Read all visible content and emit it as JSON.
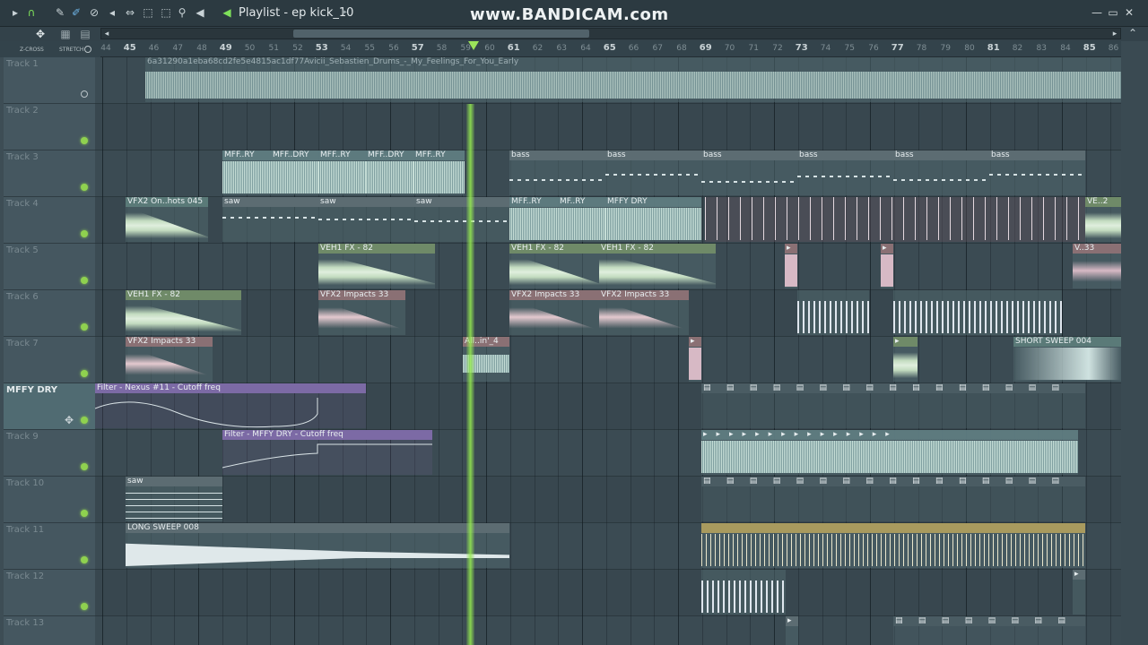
{
  "window": {
    "title": "Playlist - ep kick_10",
    "watermark": "www.BANDICAM.com"
  },
  "toolbar": {
    "icons": [
      "arrow-right-icon",
      "magnet-icon",
      "pencil-icon",
      "brush-icon",
      "mute-icon",
      "slice-icon",
      "select-icon",
      "zoom-icon",
      "speaker-icon",
      "play-icon"
    ],
    "zcross_label": "Z-CROSS",
    "stretch_label": "STRETCH"
  },
  "ruler": {
    "bars": [
      "44",
      "45",
      "46",
      "47",
      "48",
      "49",
      "50",
      "51",
      "52",
      "53",
      "54",
      "55",
      "56",
      "57",
      "58",
      "59",
      "60",
      "61",
      "62",
      "63",
      "64",
      "65",
      "66",
      "67",
      "68",
      "69",
      "70",
      "71",
      "72",
      "73",
      "74",
      "75",
      "76",
      "77",
      "78",
      "79",
      "80",
      "81",
      "82",
      "83",
      "84",
      "85",
      "86"
    ],
    "major": [
      "45",
      "49",
      "53",
      "57",
      "61",
      "65",
      "69",
      "73",
      "77",
      "81",
      "85"
    ]
  },
  "tracks": [
    {
      "name": "Track 1",
      "led": "off"
    },
    {
      "name": "Track 2",
      "led": "on"
    },
    {
      "name": "Track 3",
      "led": "on"
    },
    {
      "name": "Track 4",
      "led": "on"
    },
    {
      "name": "Track 5",
      "led": "on"
    },
    {
      "name": "Track 6",
      "led": "on"
    },
    {
      "name": "Track 7",
      "led": "on"
    },
    {
      "name": "MFFY DRY",
      "led": "on"
    },
    {
      "name": "Track 9",
      "led": "on"
    },
    {
      "name": "Track 10",
      "led": "on"
    },
    {
      "name": "Track 11",
      "led": "on"
    },
    {
      "name": "Track 12",
      "led": "on"
    },
    {
      "name": "Track 13",
      "led": "on"
    }
  ],
  "clips": {
    "t1_sample": "6a31290a1eba68cd2fe5e4815ac1df77Avicii_Sebastien_Drums_-_My_Feelings_For_You_Early",
    "t3": [
      "MFF..RY",
      "MFF..DRY",
      "MFF..RY",
      "MFF..DRY",
      "MFF..RY",
      "bass",
      "bass",
      "bass",
      "bass",
      "bass",
      "bass"
    ],
    "t4": [
      "VFX2 On..hots 045",
      "saw",
      "saw",
      "saw",
      "MFF..RY",
      "MF..RY",
      "MFFY DRY",
      "VE..2"
    ],
    "t5": [
      "VEH1 FX - 82",
      "VEH1 FX - 82",
      "VEH1 FX - 82",
      "V..33"
    ],
    "t6": [
      "VEH1 FX - 82",
      "VFX2 Impacts 33",
      "VFX2 Impacts 33",
      "VFX2 Impacts 33"
    ],
    "t7": [
      "VFX2 Impacts 33",
      "All..in'_4",
      "SHORT SWEEP 004"
    ],
    "t8": [
      "Filter - Nexus #11 - Cutoff freq"
    ],
    "t9": [
      "Filter - MFFY DRY - Cutoff freq"
    ],
    "t10": [
      "saw"
    ],
    "t11": [
      "LONG SWEEP 008"
    ]
  }
}
